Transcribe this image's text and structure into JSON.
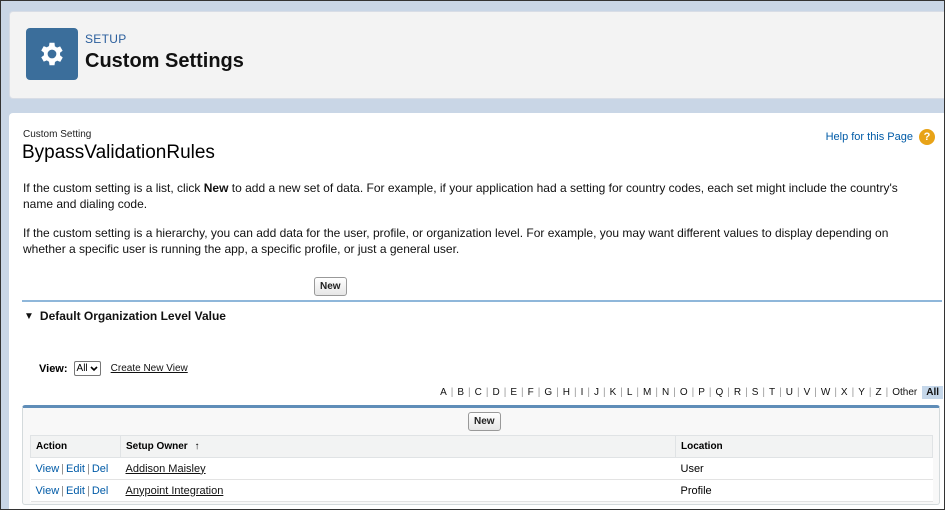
{
  "header": {
    "section": "SETUP",
    "title": "Custom Settings"
  },
  "content": {
    "label": "Custom Setting",
    "title": "BypassValidationRules",
    "help_link": "Help for this Page",
    "help_icon": "?",
    "paragraph1_prefix": "If the custom setting is a list, click ",
    "paragraph1_bold": "New",
    "paragraph1_suffix": " to add a new set of data. For example, if your application had a setting for country codes, each set might include the country's name and dialing code.",
    "paragraph2": "If the custom setting is a hierarchy, you can add data for the user, profile, or organization level. For example, you may want different values to display depending on whether a specific user is running the app, a specific profile, or just a general user.",
    "new_button": "New"
  },
  "section": {
    "title": "Default Organization Level Value"
  },
  "view": {
    "label": "View:",
    "selected": "All",
    "create_link": "Create New View"
  },
  "alphabet": [
    "A",
    "B",
    "C",
    "D",
    "E",
    "F",
    "G",
    "H",
    "I",
    "J",
    "K",
    "L",
    "M",
    "N",
    "O",
    "P",
    "Q",
    "R",
    "S",
    "T",
    "U",
    "V",
    "W",
    "X",
    "Y",
    "Z",
    "Other",
    "All"
  ],
  "list": {
    "new_button": "New",
    "columns": {
      "action": "Action",
      "owner": "Setup Owner",
      "owner_sort": "↑",
      "location": "Location"
    },
    "action_labels": {
      "view": "View",
      "edit": "Edit",
      "del": "Del",
      "sep": "|"
    },
    "rows": [
      {
        "owner": "Addison Maisley",
        "location": "User"
      },
      {
        "owner": "Anypoint Integration",
        "location": "Profile"
      }
    ]
  }
}
